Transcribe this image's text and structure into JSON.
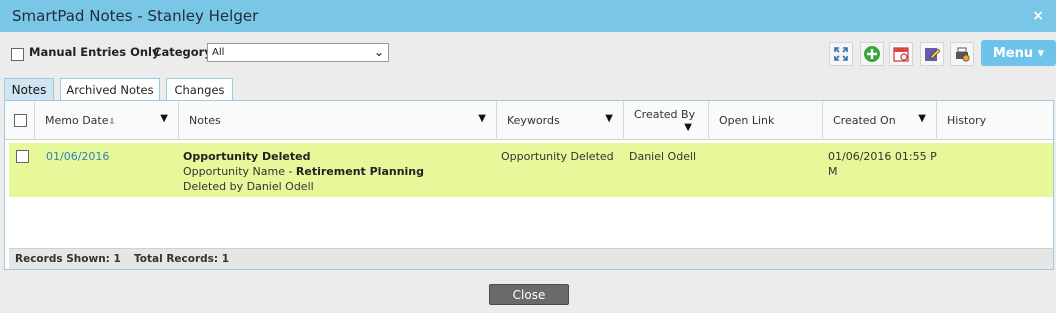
{
  "window": {
    "title": "SmartPad Notes - Stanley Helger",
    "close_glyph": "×"
  },
  "filters": {
    "manual_entries_label": "Manual Entries Only",
    "category_label": "Category",
    "category_value": "All"
  },
  "toolbar_icons": [
    "expand-icon",
    "add-icon",
    "calendar-icon",
    "note-edit-icon",
    "print-settings-icon"
  ],
  "menu": {
    "label": "Menu ▾"
  },
  "tabs": [
    {
      "label": "Notes",
      "active": true
    },
    {
      "label": "Archived Notes",
      "active": false
    },
    {
      "label": "Changes",
      "active": false
    }
  ],
  "columns": {
    "memo_date": "Memo Date",
    "notes": "Notes",
    "keywords": "Keywords",
    "created_by": "Created By",
    "open_link": "Open Link",
    "created_on": "Created On",
    "history": "History"
  },
  "rows": [
    {
      "memo_date": "01/06/2016",
      "note_title": "Opportunity Deleted",
      "note_line2_prefix": "Opportunity Name - ",
      "note_line2_bold": "Retirement Planning",
      "note_line3": "Deleted by Daniel Odell",
      "keywords": "Opportunity Deleted",
      "created_by": "Daniel Odell",
      "created_on_line1": "01/06/2016 01:55 P",
      "created_on_line2": "M"
    }
  ],
  "footer": {
    "records_shown": "Records Shown: 1",
    "total_records": "Total Records: 1"
  },
  "close_button": "Close",
  "colors": {
    "titlebar": "#7ac6e6",
    "row_highlight": "#e7f89a",
    "menu_button": "#6ec3ea",
    "link": "#2f7fc1"
  }
}
